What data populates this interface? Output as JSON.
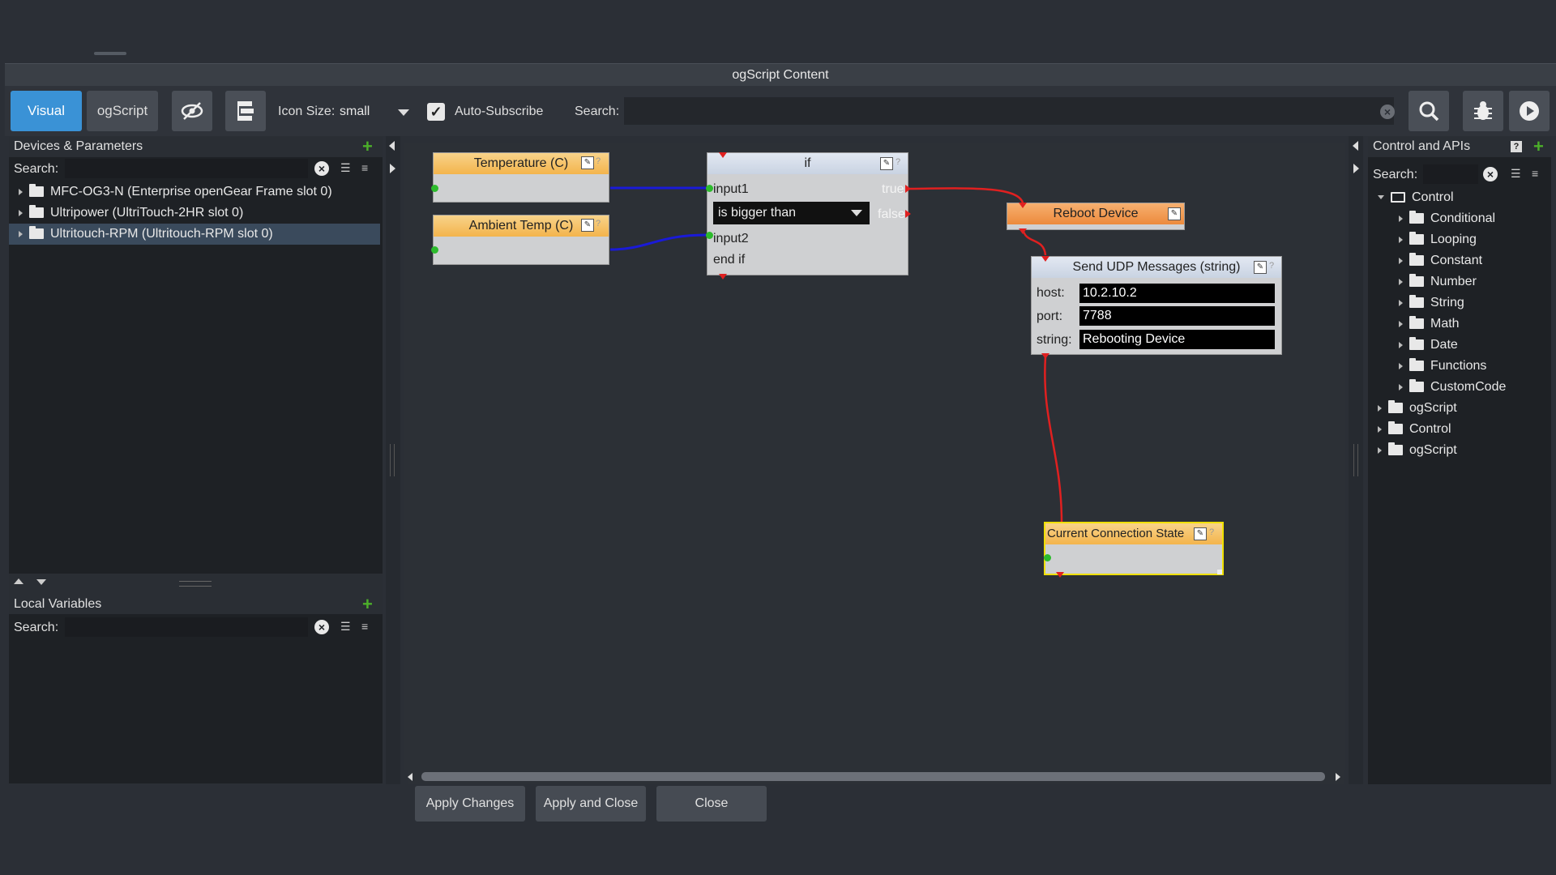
{
  "window": {
    "title": "ogScript Content"
  },
  "toolbar": {
    "tab_visual": "Visual",
    "tab_ogscript": "ogScript",
    "icon_size_label": "Icon Size:",
    "icon_size_value": "small",
    "auto_subscribe_label": "Auto-Subscribe",
    "auto_subscribe_checked": true,
    "search_label": "Search:",
    "search_value": ""
  },
  "left_panel": {
    "title": "Devices & Parameters",
    "search_label": "Search:",
    "items": [
      {
        "label": "MFC-OG3-N (Enterprise openGear Frame slot 0)",
        "selected": false
      },
      {
        "label": "Ultripower (UltriTouch-2HR slot 0)",
        "selected": false
      },
      {
        "label": "Ultritouch-RPM (Ultritouch-RPM slot 0)",
        "selected": true
      }
    ]
  },
  "local_vars": {
    "title": "Local Variables",
    "search_label": "Search:"
  },
  "right_panel": {
    "title": "Control and APIs",
    "search_label": "Search:",
    "help": "?",
    "tree": [
      {
        "label": "Control",
        "expanded": true,
        "depth": 0
      },
      {
        "label": "Conditional",
        "depth": 1
      },
      {
        "label": "Looping",
        "depth": 1
      },
      {
        "label": "Constant",
        "depth": 1
      },
      {
        "label": "Number",
        "depth": 1
      },
      {
        "label": "String",
        "depth": 1
      },
      {
        "label": "Math",
        "depth": 1
      },
      {
        "label": "Date",
        "depth": 1
      },
      {
        "label": "Functions",
        "depth": 1
      },
      {
        "label": "CustomCode",
        "depth": 1
      },
      {
        "label": "ogScript",
        "depth": 0
      },
      {
        "label": "Control",
        "depth": 0
      },
      {
        "label": "ogScript",
        "depth": 0
      }
    ]
  },
  "nodes": {
    "temperature": {
      "title": "Temperature (C)"
    },
    "ambient": {
      "title": "Ambient Temp (C)"
    },
    "if_node": {
      "title": "if",
      "input1": "input1",
      "input2": "input2",
      "operator": "is bigger than",
      "end": "end if",
      "true_label": "true",
      "false_label": "false"
    },
    "reboot": {
      "title": "Reboot Device"
    },
    "udp": {
      "title": "Send UDP Messages (string)",
      "host_label": "host:",
      "host_value": "10.2.10.2",
      "port_label": "port:",
      "port_value": "7788",
      "string_label": "string:",
      "string_value": "Rebooting Device"
    },
    "conn_state": {
      "title": "Current Connection State"
    }
  },
  "buttons": {
    "apply_changes": "Apply Changes",
    "apply_close": "Apply and Close",
    "close": "Close"
  },
  "colors": {
    "accent": "#3a92d6",
    "wire_blue": "#1a1ad8",
    "wire_red": "#e02020",
    "port_green": "#2dbb2d"
  },
  "icons": [
    "hide-icon",
    "layout-icon",
    "search-icon",
    "debug-icon",
    "play-icon",
    "add-icon",
    "clear-icon",
    "sort-icon",
    "filter-icon",
    "edit-icon",
    "help-icon"
  ]
}
